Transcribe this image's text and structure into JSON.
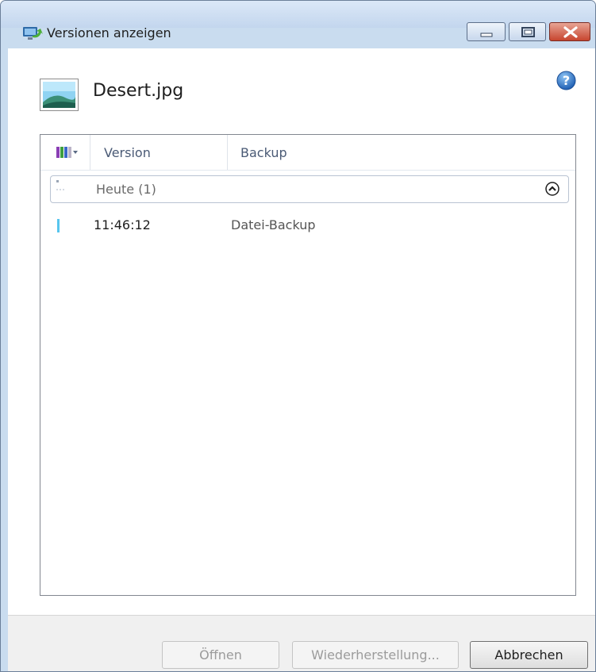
{
  "window": {
    "title": "Versionen anzeigen",
    "app_icon": "computer-backup-icon",
    "controls": [
      "minimize-icon",
      "maximize-icon",
      "close-icon"
    ]
  },
  "file": {
    "name": "Desert.jpg",
    "icon": "image-file-icon"
  },
  "help_icon": "help-icon",
  "list": {
    "column_chooser_icon": "column-chooser-icon",
    "columns": [
      "Version",
      "Backup"
    ],
    "groups": [
      {
        "title": "Heute (1)",
        "expanded": true,
        "rows": [
          {
            "version": "11:46:12",
            "backup": "Datei-Backup"
          }
        ]
      }
    ]
  },
  "buttons": {
    "open": "Öffnen",
    "restore": "Wiederherstellung...",
    "cancel": "Abbrechen"
  },
  "colors": {
    "row_marker": "#57c5ee",
    "close_button": "#c7452f"
  }
}
